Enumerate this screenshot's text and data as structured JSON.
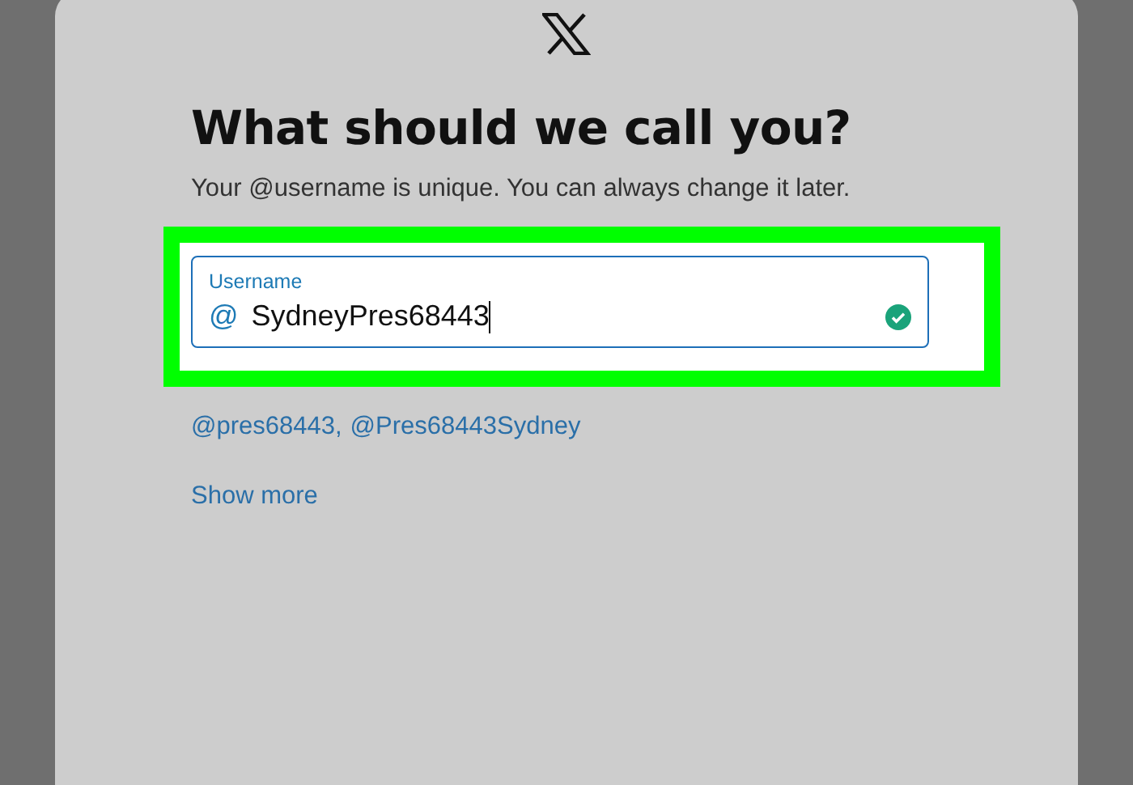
{
  "dialog": {
    "title": "What should we call you?",
    "subtitle": "Your @username is unique. You can always change it later.",
    "username_field": {
      "label": "Username",
      "prefix": "@",
      "value": "SydneyPres68443",
      "valid": true,
      "highlighted": true
    },
    "suggestions": [
      "@pres68443,",
      "@Pres68443Sydney"
    ],
    "show_more": "Show more"
  }
}
